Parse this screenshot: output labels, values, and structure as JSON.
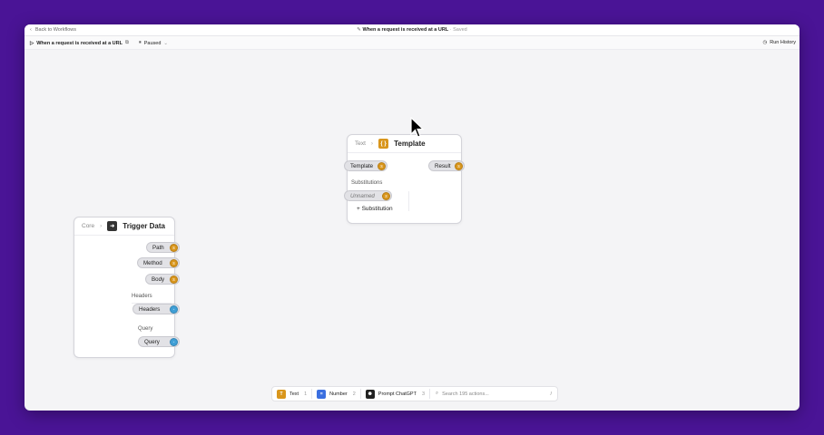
{
  "topbar": {
    "back_label": "Back to Workflows",
    "workflow_title": "When a request is received at a URL",
    "save_status": "· Saved"
  },
  "subbar": {
    "trigger_label": "When a request is received at a URL",
    "status_label": "Paused",
    "run_history_label": "Run History"
  },
  "trigger_node": {
    "crumb": "Core",
    "title": "Trigger Data",
    "outputs": [
      {
        "label": "Path",
        "type": "text"
      },
      {
        "label": "Method",
        "type": "text"
      },
      {
        "label": "Body",
        "type": "text"
      }
    ],
    "headers_section": "Headers",
    "headers_port": "Headers",
    "query_section": "Query",
    "query_port": "Query"
  },
  "template_node": {
    "crumb": "Text",
    "title": "Template",
    "input_port": "Template",
    "output_port": "Result",
    "substitutions_label": "Substitutions",
    "unnamed_port": "Unnamed",
    "add_substitution": "+ Substitution"
  },
  "toolbar": {
    "items": [
      {
        "label": "Text",
        "key": "1",
        "color": "#d9961c",
        "icon": "text-type-icon"
      },
      {
        "label": "Number",
        "key": "2",
        "color": "#3b6fe0",
        "icon": "number-type-icon"
      },
      {
        "label": "Prompt ChatGPT",
        "key": "3",
        "color": "#222222",
        "icon": "chatgpt-icon"
      }
    ],
    "search_placeholder": "Search 195 actions...",
    "search_shortcut": "/"
  },
  "colors": {
    "background": "#4a1496",
    "text_port": "#d9961c",
    "object_port": "#3f9fd6"
  }
}
